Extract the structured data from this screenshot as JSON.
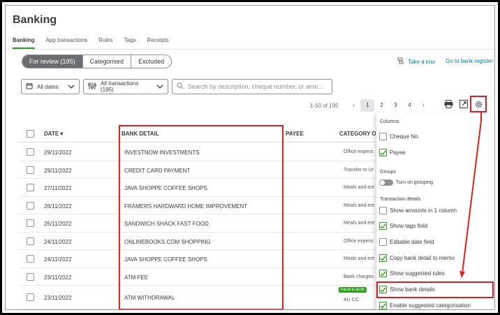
{
  "page": {
    "title": "Banking"
  },
  "tabs": [
    {
      "label": "Banking",
      "active": true
    },
    {
      "label": "App transactions"
    },
    {
      "label": "Rules"
    },
    {
      "label": "Tags"
    },
    {
      "label": "Receipts"
    }
  ],
  "review_tabs": [
    {
      "label": "For review (195)",
      "selected": true
    },
    {
      "label": "Categorised"
    },
    {
      "label": "Excluded"
    }
  ],
  "links": {
    "take_tour": "Take a tour",
    "go_to_register": "Go to bank register"
  },
  "filters": {
    "dates": "All dates",
    "transactions": "All transactions (195)",
    "search_placeholder": "Search by description, cheque number, or amo..."
  },
  "pagination": {
    "range": "1-50 of 195",
    "pages": [
      "1",
      "2",
      "3",
      "4"
    ],
    "current": "1"
  },
  "table": {
    "headers": {
      "date": "DATE",
      "bank_detail": "BANK DETAIL",
      "payee": "PAYEE",
      "category": "CATEGORY O"
    },
    "rows": [
      {
        "date": "29/11/2022",
        "bank_detail": "INVESTNOW INVESTMENTS",
        "category": "Office expens"
      },
      {
        "date": "29/11/2022",
        "bank_detail": "CREDIT CARD PAYMENT",
        "category": "Transfer to Ur"
      },
      {
        "date": "27/11/2022",
        "bank_detail": "JAVA SHOPPE COFFEE SHOPS",
        "category": "Meals and ent"
      },
      {
        "date": "26/11/2022",
        "bank_detail": "FRAMERS HARDWARD HOME IMPROVEMENT",
        "category": "Meals and ent"
      },
      {
        "date": "25/11/2022",
        "bank_detail": "SANDWICH SHACK FAST FOOD",
        "category": "Meals and ent"
      },
      {
        "date": "24/11/2022",
        "bank_detail": "ONLINEBOOKS.COM SHOPPING",
        "category": "Office expens"
      },
      {
        "date": "24/11/2022",
        "bank_detail": "JAVA SHOPPE COFFEE SHOPS",
        "category": "Meals and ent"
      },
      {
        "date": "23/11/2022",
        "bank_detail": "ATM FEE",
        "category": "Bank charges"
      },
      {
        "date": "23/11/2022",
        "bank_detail": "ATM WITHDRAWAL",
        "category": "AU CC",
        "badge": "Paired to anoth"
      }
    ]
  },
  "settings_panel": {
    "columns_heading": "Columns",
    "cheque_no": "Cheque No.",
    "payee": "Payee",
    "groups_heading": "Groups",
    "turn_on_grouping": "Turn on grouping",
    "transaction_details_heading": "Transaction details",
    "show_amounts": "Show amounts in 1 column",
    "show_tags": "Show tags field",
    "editable_date": "Editable date field",
    "copy_bank_detail": "Copy bank detail to memo",
    "show_suggested_rules": "Show suggested rules",
    "show_bank_details": "Show bank details",
    "enable_suggested": "Enable suggested categorisation"
  },
  "colors": {
    "accent_green": "#2ca01c",
    "link_blue": "#0077c5",
    "highlight_red": "#e01e1e"
  }
}
